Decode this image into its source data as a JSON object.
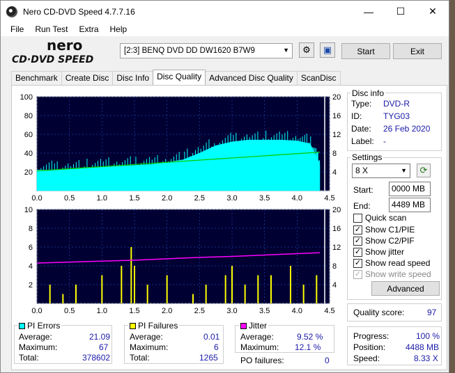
{
  "window": {
    "title": "Nero CD-DVD Speed 4.7.7.16",
    "minimize": "—",
    "maximize": "☐",
    "close": "✕"
  },
  "menu": [
    "File",
    "Run Test",
    "Extra",
    "Help"
  ],
  "toolbar": {
    "logo_top": "nero",
    "logo_bottom": "CD·DVD SPEED",
    "drive": "[2:3]   BENQ DVD DD DW1620 B7W9",
    "start_label": "Start",
    "exit_label": "Exit"
  },
  "tabs": [
    "Benchmark",
    "Create Disc",
    "Disc Info",
    "Disc Quality",
    "Advanced Disc Quality",
    "ScanDisc"
  ],
  "active_tab": "Disc Quality",
  "disc_info": {
    "title": "Disc info",
    "type_label": "Type:",
    "type": "DVD-R",
    "id_label": "ID:",
    "id": "TYG03",
    "date_label": "Date:",
    "date": "26 Feb 2020",
    "label_label": "Label:",
    "label": "-"
  },
  "settings": {
    "title": "Settings",
    "speed": "8 X",
    "start_label": "Start:",
    "start": "0000 MB",
    "end_label": "End:",
    "end": "4489 MB",
    "quick_scan": "Quick scan",
    "show_c1pie": "Show C1/PIE",
    "show_c2pif": "Show C2/PIF",
    "show_jitter": "Show jitter",
    "show_read_speed": "Show read speed",
    "show_write_speed": "Show write speed",
    "advanced": "Advanced"
  },
  "quality": {
    "label": "Quality score:",
    "value": "97"
  },
  "progress": {
    "progress_label": "Progress:",
    "progress": "100 %",
    "position_label": "Position:",
    "position": "4488 MB",
    "speed_label": "Speed:",
    "speed": "8.33 X"
  },
  "pi_errors": {
    "title": "PI Errors",
    "color": "#00ffff",
    "average_label": "Average:",
    "average": "21.09",
    "maximum_label": "Maximum:",
    "maximum": "67",
    "total_label": "Total:",
    "total": "378602"
  },
  "pi_failures": {
    "title": "PI Failures",
    "color": "#ffff00",
    "average_label": "Average:",
    "average": "0.01",
    "maximum_label": "Maximum:",
    "maximum": "6",
    "total_label": "Total:",
    "total": "1265"
  },
  "jitter": {
    "title": "Jitter",
    "color": "#ff00ff",
    "average_label": "Average:",
    "average": "9.52 %",
    "maximum_label": "Maximum:",
    "maximum": "12.1 %",
    "po_label": "PO failures:",
    "po": "0"
  },
  "chart_data": [
    {
      "type": "area",
      "x_ticks": [
        "0.0",
        "0.5",
        "1.0",
        "1.5",
        "2.0",
        "2.5",
        "3.0",
        "3.5",
        "4.0",
        "4.5"
      ],
      "y_left_ticks": [
        "100",
        "80",
        "60",
        "40",
        "20"
      ],
      "y_right_ticks": [
        "20",
        "16",
        "12",
        "8",
        "4"
      ],
      "xlim": [
        0,
        4.5
      ],
      "ylim": [
        0,
        100
      ],
      "y2lim": [
        0,
        20
      ],
      "series": [
        {
          "color": "#00ffff",
          "x": [
            0.0,
            0.25,
            0.5,
            0.75,
            1.0,
            1.25,
            1.5,
            1.75,
            2.0,
            2.25,
            2.5,
            2.75,
            3.0,
            3.25,
            3.5,
            3.75,
            4.0,
            4.2,
            4.3,
            4.35
          ],
          "values": [
            22,
            22,
            23,
            24,
            25,
            26,
            27,
            28,
            30,
            33,
            40,
            48,
            52,
            54,
            54,
            54,
            53,
            50,
            36,
            28
          ]
        },
        {
          "color": "#00cc00",
          "x": [
            0.0,
            4.35
          ],
          "values": [
            4.2,
            8.2
          ]
        }
      ]
    },
    {
      "type": "bar",
      "x_ticks": [
        "0.0",
        "0.5",
        "1.0",
        "1.5",
        "2.0",
        "2.5",
        "3.0",
        "3.5",
        "4.0",
        "4.5"
      ],
      "y_left_ticks": [
        "10",
        "8",
        "6",
        "4",
        "2"
      ],
      "y_right_ticks": [
        "20",
        "16",
        "12",
        "8",
        "4"
      ],
      "xlim": [
        0,
        4.5
      ],
      "ylim": [
        0,
        10
      ],
      "y2lim": [
        0,
        20
      ],
      "series": [
        {
          "color": "#ffff00",
          "x": [
            0.2,
            0.4,
            0.6,
            1.0,
            1.3,
            1.45,
            1.5,
            1.7,
            2.0,
            2.4,
            2.6,
            2.9,
            3.0,
            3.2,
            3.4,
            3.6,
            3.9,
            4.1,
            4.3
          ],
          "values": [
            2,
            1,
            2,
            3,
            4,
            6,
            4,
            2,
            3,
            1,
            2,
            3,
            4,
            2,
            3,
            3,
            4,
            2,
            3
          ]
        },
        {
          "color": "#ff00ff",
          "x": [
            0.0,
            0.5,
            1.0,
            1.5,
            2.0,
            2.5,
            3.0,
            3.5,
            4.0,
            4.35
          ],
          "values": [
            8.6,
            8.8,
            9.0,
            9.2,
            9.5,
            9.8,
            10.0,
            10.3,
            10.6,
            10.8
          ]
        }
      ]
    }
  ]
}
